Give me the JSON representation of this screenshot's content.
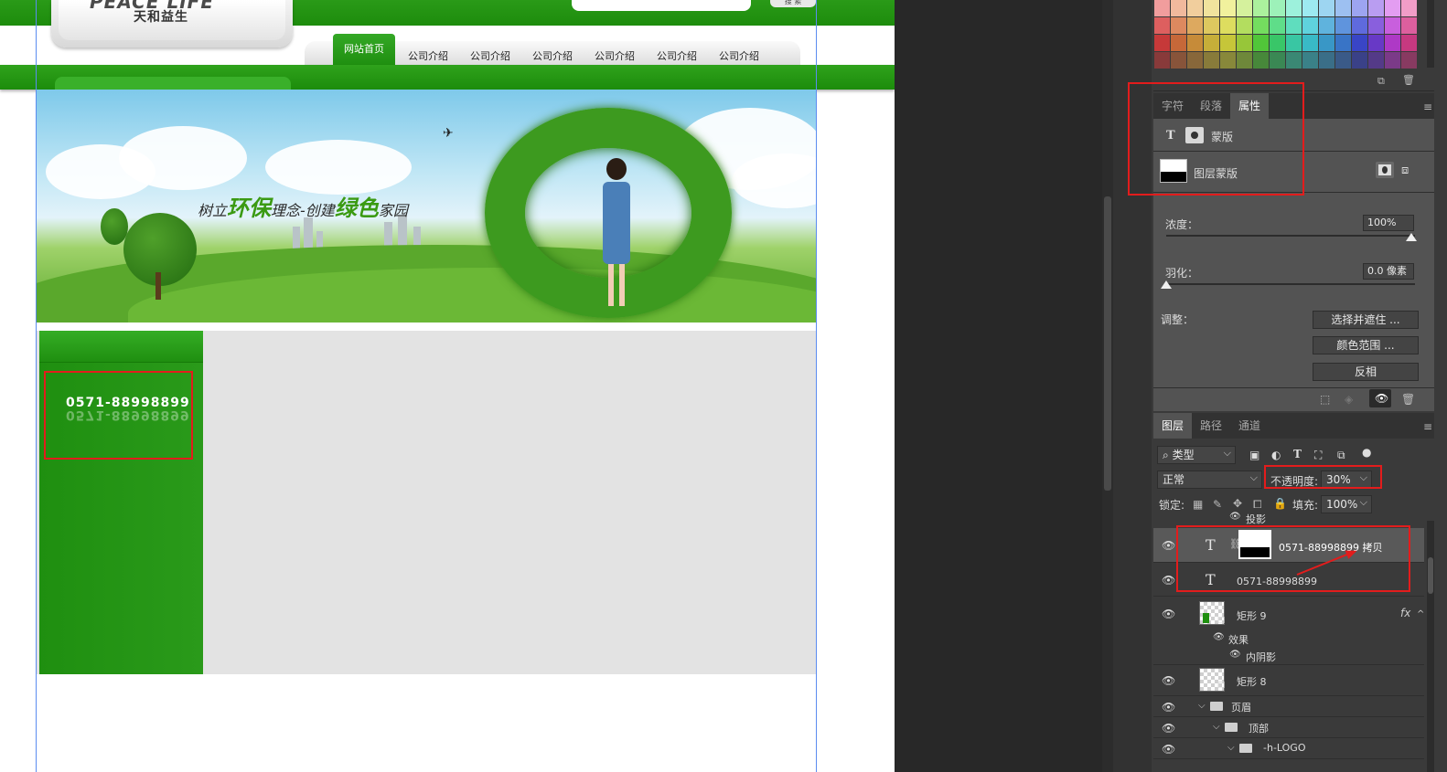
{
  "canvas": {
    "logo_en": "PEACE LIFE",
    "logo_cn": "天和益生",
    "search_button": "搜 索",
    "nav_active": "网站首页",
    "nav_items": [
      "公司介绍",
      "公司介绍",
      "公司介绍",
      "公司介绍",
      "公司介绍",
      "公司介绍"
    ],
    "banner_slogan": {
      "part1": "树立",
      "highlight1": "环保",
      "part2": "理念-",
      "part3": "创建",
      "highlight2": "绿色",
      "part4": "家园"
    },
    "phone": "0571-88998899",
    "phone_reflection": "0571-88998899"
  },
  "properties_panel": {
    "tabs": [
      "字符",
      "段落",
      "属性"
    ],
    "active_tab": "属性",
    "mask_type_label": "蒙版",
    "layer_mask_label": "图层蒙版",
    "density_label": "浓度：",
    "density_value": "100%",
    "feather_label": "羽化：",
    "feather_value": "0.0 像素",
    "adjust_label": "调整：",
    "btn_select_mask": "选择并遮住 ...",
    "btn_color_range": "颜色范围 ...",
    "btn_invert": "反相"
  },
  "layers_panel": {
    "tabs": [
      "图层",
      "路径",
      "通道"
    ],
    "active_tab": "图层",
    "filter_kind": "类型",
    "blend_mode": "正常",
    "opacity_label": "不透明度:",
    "opacity_value": "30%",
    "lock_label": "锁定:",
    "fill_label": "填充:",
    "fill_value": "100%",
    "partial_row_label": "投影",
    "layers": [
      {
        "name": "0571-88998899 拷贝",
        "type": "text",
        "has_mask": true,
        "selected": true
      },
      {
        "name": "0571-88998899",
        "type": "text"
      },
      {
        "name": "矩形 9",
        "type": "shape",
        "fx": "fx"
      },
      {
        "name": "效果",
        "type": "effect-group"
      },
      {
        "name": "内阴影",
        "type": "effect"
      },
      {
        "name": "矩形 8",
        "type": "shape"
      },
      {
        "name": "页眉",
        "type": "group"
      },
      {
        "name": "顶部",
        "type": "group"
      },
      {
        "name": "-h-LOGO",
        "type": "group"
      }
    ]
  },
  "colors": {
    "brand_green": "#1f8f10",
    "ps_panel": "#3a3a3a",
    "annotation_red": "#e31c1c",
    "guide_blue": "#5b8cf0"
  }
}
